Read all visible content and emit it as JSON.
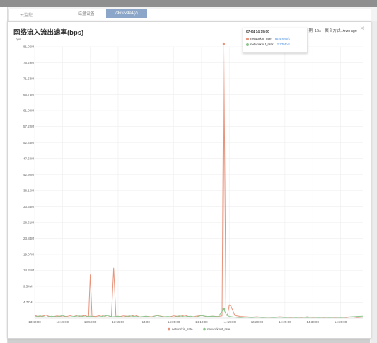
{
  "background": {
    "breadcrumb": "云监控",
    "tabs": [
      {
        "label": "磁盘设备"
      },
      {
        "label": "/dev/vda1(/)"
      }
    ]
  },
  "modal": {
    "title": "网络流入流出速率(bps)",
    "period_label": "周期: 15s",
    "aggregation_label": "聚合方式: Average",
    "close_icon": "close-icon"
  },
  "tooltip": {
    "time": "07-04 14:15:00",
    "rows": [
      {
        "name": "networkin_rate:",
        "value": "82.49Mb/s"
      },
      {
        "name": "networkout_rate:",
        "value": "2.74Mb/s"
      }
    ]
  },
  "colors": {
    "networkin": "#e8927a",
    "networkout": "#8cc58f",
    "grid": "#eeeeee",
    "axis_text": "#666666"
  },
  "chart_data": {
    "type": "line",
    "title": "网络流入流出速率(bps)",
    "ylabel": "bps",
    "xlabel": "",
    "ylim": [
      0,
      81.06
    ],
    "y_ticks": [
      "4.77M",
      "9.54M",
      "14.31M",
      "19.07M",
      "23.84M",
      "28.61M",
      "33.38M",
      "38.15M",
      "42.92M",
      "47.69M",
      "52.45M",
      "57.22M",
      "61.99M",
      "66.76M",
      "71.53M",
      "76.29M",
      "81.06M"
    ],
    "y_tick_values": [
      4.77,
      9.54,
      14.31,
      19.07,
      23.84,
      28.61,
      33.38,
      38.15,
      42.92,
      47.69,
      52.45,
      57.22,
      61.99,
      66.76,
      71.53,
      76.29,
      81.06
    ],
    "x_ticks": [
      "13:40:00",
      "13:45:00",
      "13:50:00",
      "13:55:00",
      "14:00",
      "14:05:00",
      "14:10:00",
      "14:15:00",
      "14:20:00",
      "14:25:00",
      "14:30:00",
      "14:35:00"
    ],
    "x_range_minutes": [
      0,
      59
    ],
    "x_tick_minutes": [
      0,
      5,
      10,
      15,
      20,
      25,
      30,
      35,
      40,
      45,
      50,
      55
    ],
    "grid": true,
    "legend_position": "bottom-center",
    "series": [
      {
        "name": "networkin_rate",
        "color": "#e8927a",
        "x": [
          0,
          1,
          2,
          3,
          4,
          5,
          6,
          7,
          8,
          9,
          9.7,
          10,
          10.3,
          11,
          12,
          13,
          13.8,
          14.2,
          14.6,
          15,
          16,
          17,
          18,
          19,
          20,
          21,
          22,
          23,
          24,
          25,
          26,
          27,
          28,
          29,
          30,
          31,
          32,
          33,
          33.7,
          34,
          34.4,
          34.7,
          35,
          35.3,
          35.6,
          36,
          37,
          38,
          39,
          40,
          41,
          42,
          43,
          44,
          45,
          46,
          47,
          48,
          49,
          50,
          51,
          52,
          53,
          54,
          55,
          56,
          57,
          58,
          59
        ],
        "y": [
          0.8,
          0.4,
          0.9,
          0.3,
          0.7,
          0.4,
          0.6,
          1.0,
          0.5,
          0.8,
          0.4,
          13.0,
          0.6,
          0.5,
          0.9,
          0.3,
          0.5,
          15.0,
          0.6,
          0.4,
          0.7,
          0.5,
          0.9,
          0.3,
          0.6,
          0.4,
          0.8,
          0.5,
          0.3,
          0.7,
          0.5,
          0.9,
          0.3,
          0.6,
          0.8,
          0.4,
          0.6,
          0.5,
          0.7,
          82.49,
          0.8,
          1.2,
          4.0,
          3.6,
          2.4,
          0.8,
          0.5,
          0.4,
          0.3,
          0.4,
          0.2,
          0.3,
          0.2,
          0.4,
          0.3,
          0.2,
          0.3,
          0.2,
          0.4,
          0.2,
          0.3,
          0.2,
          0.3,
          0.2,
          0.3,
          0.2,
          0.4,
          0.2,
          0.3
        ]
      },
      {
        "name": "networkout_rate",
        "color": "#8cc58f",
        "x": [
          0,
          1,
          2,
          3,
          4,
          5,
          6,
          7,
          8,
          9,
          10,
          11,
          12,
          13,
          14,
          15,
          16,
          17,
          18,
          19,
          20,
          21,
          22,
          23,
          24,
          25,
          26,
          27,
          28,
          29,
          30,
          31,
          32,
          33,
          34,
          34.5,
          35,
          36,
          37,
          38,
          39,
          40,
          41,
          42,
          43,
          44,
          45,
          46,
          47,
          48,
          49,
          50,
          51,
          52,
          53,
          54,
          55,
          56,
          57,
          58,
          59
        ],
        "y": [
          0.4,
          0.7,
          0.3,
          0.6,
          0.4,
          0.8,
          0.3,
          0.5,
          0.7,
          0.4,
          0.6,
          0.3,
          0.5,
          0.8,
          0.4,
          0.6,
          0.3,
          0.7,
          0.5,
          0.4,
          0.6,
          0.3,
          0.8,
          0.4,
          0.5,
          0.3,
          0.7,
          0.4,
          0.6,
          0.3,
          0.8,
          0.5,
          0.6,
          0.4,
          2.74,
          0.9,
          0.5,
          0.3,
          0.2,
          0.3,
          0.2,
          0.3,
          0.2,
          0.3,
          0.2,
          0.3,
          0.2,
          0.3,
          0.2,
          0.3,
          0.2,
          0.3,
          0.2,
          0.3,
          0.2,
          0.3,
          0.2,
          0.3,
          0.4,
          0.5,
          0.6
        ]
      }
    ]
  }
}
